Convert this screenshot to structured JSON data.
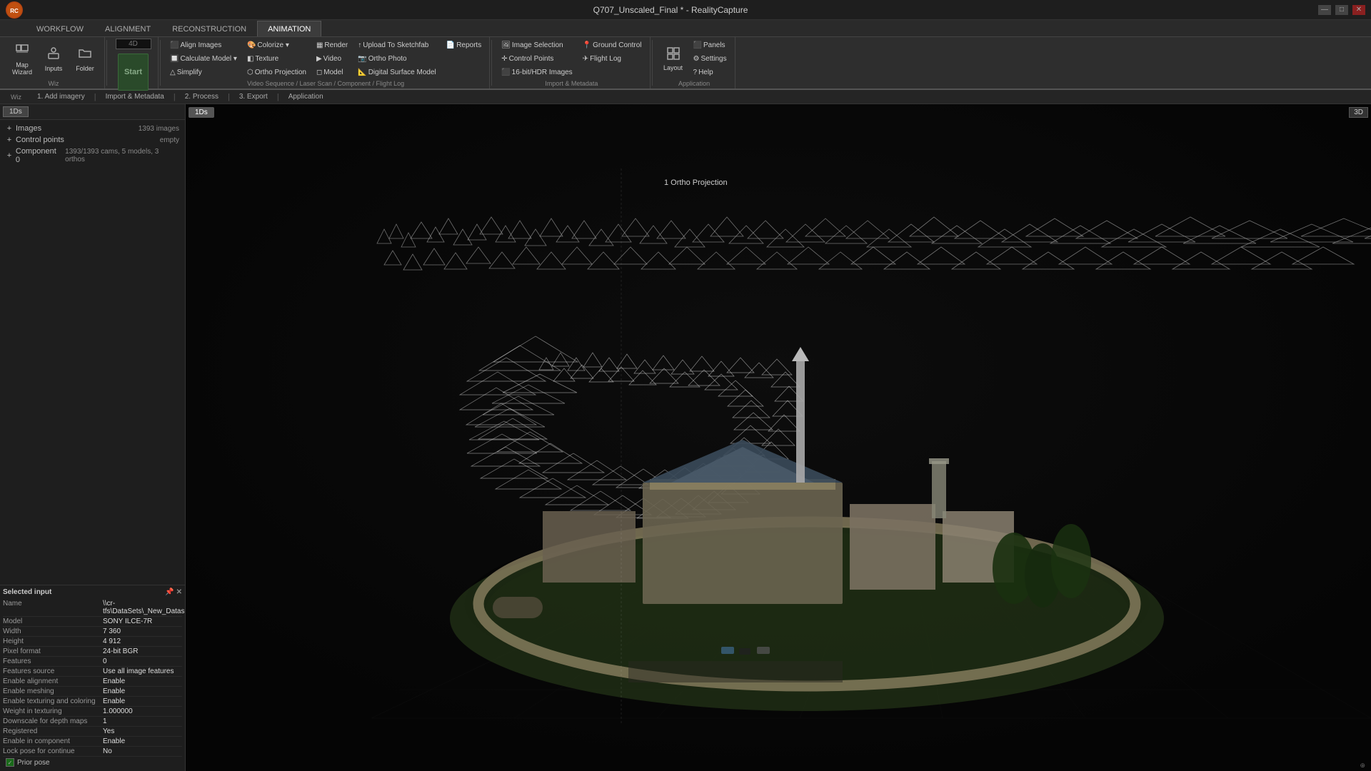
{
  "titleBar": {
    "title": "Q707_Unscaled_Final * - RealityCapture",
    "logoText": "RC",
    "windowControls": [
      "—",
      "□",
      "✕"
    ],
    "rcLabel": "RC"
  },
  "ribbonTabs": [
    {
      "label": "WORKFLOW",
      "active": false
    },
    {
      "label": "ALIGNMENT",
      "active": false
    },
    {
      "label": "RECONSTRUCTION",
      "active": false
    },
    {
      "label": "ANIMATION",
      "active": true
    }
  ],
  "ribbon": {
    "groups": [
      {
        "name": "playback",
        "label": "",
        "items": [
          {
            "type": "input",
            "value": "",
            "placeholder": "4D"
          },
          {
            "type": "button",
            "label": "Start",
            "icon": "▶"
          }
        ]
      },
      {
        "name": "sequence",
        "label": "Video Sequence",
        "items": [
          {
            "label": "Align Images",
            "icon": "⬛"
          },
          {
            "label": "Colorize",
            "icon": "🎨",
            "hasDropdown": true
          },
          {
            "label": "Render",
            "icon": "▦"
          },
          {
            "label": "Upload To Sketchfab",
            "icon": "↑"
          },
          {
            "label": "Reports",
            "icon": "📄"
          }
        ]
      },
      {
        "name": "import",
        "label": "Laser Scan",
        "items": [
          {
            "label": "Ground Control",
            "icon": "📍"
          },
          {
            "label": "Calculate Model ▾",
            "icon": "🔲"
          },
          {
            "label": "Texture",
            "icon": "◧",
            "hasDropdown": true
          },
          {
            "label": "Video",
            "icon": "▶"
          },
          {
            "label": "Ortho Photo",
            "icon": "📷"
          }
        ]
      },
      {
        "name": "component",
        "label": "Component",
        "items": [
          {
            "label": "Image Selection",
            "icon": "🖼"
          },
          {
            "label": "Simplify",
            "icon": "△"
          },
          {
            "label": "Ortho Projection",
            "icon": "⬡"
          },
          {
            "label": "Model",
            "icon": "◻"
          },
          {
            "label": "Digital Surface Model",
            "icon": "📐"
          }
        ]
      },
      {
        "name": "metadata",
        "label": "Flight Log",
        "items": [
          {
            "label": "Control Points",
            "icon": "✛"
          },
          {
            "label": "16-bit/HDR Images",
            "icon": "⬛"
          }
        ]
      },
      {
        "name": "layout-group",
        "label": "Layout",
        "items": [
          {
            "label": "Panels",
            "icon": "⬛"
          },
          {
            "label": "Settings",
            "icon": "⚙"
          },
          {
            "label": "Help",
            "icon": "?"
          }
        ]
      }
    ]
  },
  "workflowBar": {
    "wiz": "Wiz",
    "items": [
      {
        "label": "1. Add imagery",
        "active": false
      },
      {
        "label": "Import & Metadata",
        "active": false
      },
      {
        "label": "2. Process",
        "active": false
      },
      {
        "label": "3. Export",
        "active": false
      },
      {
        "label": "Application",
        "active": false
      }
    ]
  },
  "sceneTree": {
    "items": [
      {
        "label": "Images",
        "count": "",
        "indent": 0
      },
      {
        "label": "Control points",
        "count": "1393 images",
        "indent": 0
      },
      {
        "label": "",
        "count": "empty",
        "indent": 1
      },
      {
        "label": "Component 0",
        "count": "1393/1393 cams, 5 models, 3 orthos",
        "indent": 0
      }
    ]
  },
  "viewport": {
    "badge1D": "1Ds",
    "badge3D": "3D",
    "orthoLabel": "1 Ortho Projection"
  },
  "properties": {
    "header": "Selected input",
    "rows": [
      {
        "key": "Name",
        "value": "\\\\cr-tfs\\DataSets\\_New_Dataset..."
      },
      {
        "key": "Model",
        "value": "SONY ILCE-7R"
      },
      {
        "key": "Width",
        "value": "7 360"
      },
      {
        "key": "Height",
        "value": "4 912"
      },
      {
        "key": "Pixel format",
        "value": "24-bit BGR"
      },
      {
        "key": "Features",
        "value": "0"
      },
      {
        "key": "Features source",
        "value": "Use all image features"
      },
      {
        "key": "Enable alignment",
        "value": "Enable"
      },
      {
        "key": "Enable meshing",
        "value": "Enable"
      },
      {
        "key": "Enable texturing and coloring",
        "value": "Enable"
      },
      {
        "key": "Weight in texturing",
        "value": "1.000000"
      },
      {
        "key": "Downscale for depth maps",
        "value": "1"
      },
      {
        "key": "Registered",
        "value": "Yes"
      },
      {
        "key": "Enable in component",
        "value": "Enable"
      },
      {
        "key": "Lock pose for continue",
        "value": "No"
      }
    ],
    "priorPose": "Prior pose"
  }
}
